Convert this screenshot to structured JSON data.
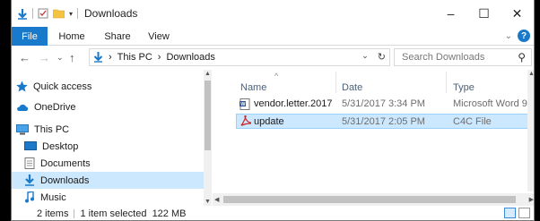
{
  "window": {
    "title": "Downloads"
  },
  "controls": {
    "minimize": "–",
    "maximize": "☐",
    "close": "✕"
  },
  "ribbon": {
    "tabs": [
      "File",
      "Home",
      "Share",
      "View"
    ],
    "help": "?"
  },
  "nav": {
    "back": "←",
    "forward": "→",
    "recent": "⌄",
    "up": "↑",
    "breadcrumb": [
      "This PC",
      "Downloads"
    ],
    "separator": "›",
    "search_placeholder": "Search Downloads"
  },
  "sidebar": {
    "items": [
      {
        "label": "Quick access",
        "icon": "star-icon"
      },
      {
        "label": "OneDrive",
        "icon": "cloud-icon"
      },
      {
        "label": "This PC",
        "icon": "computer-icon"
      },
      {
        "label": "Desktop",
        "icon": "desktop-icon"
      },
      {
        "label": "Documents",
        "icon": "documents-icon"
      },
      {
        "label": "Downloads",
        "icon": "download-icon",
        "selected": true
      },
      {
        "label": "Music",
        "icon": "music-icon"
      }
    ]
  },
  "columns": {
    "name": "Name",
    "date": "Date",
    "type": "Type"
  },
  "files": [
    {
      "name": "vendor.letter.2017",
      "date": "5/31/2017 3:34 PM",
      "type": "Microsoft Word 9...",
      "icon": "word-doc-icon"
    },
    {
      "name": "update",
      "date": "5/31/2017 2:05 PM",
      "type": "C4C File",
      "icon": "pdf-icon",
      "selected": true
    }
  ],
  "status": {
    "count": "2 items",
    "selection": "1 item selected  122 MB"
  },
  "colors": {
    "accent": "#1979ca",
    "selection": "#cce8ff"
  }
}
